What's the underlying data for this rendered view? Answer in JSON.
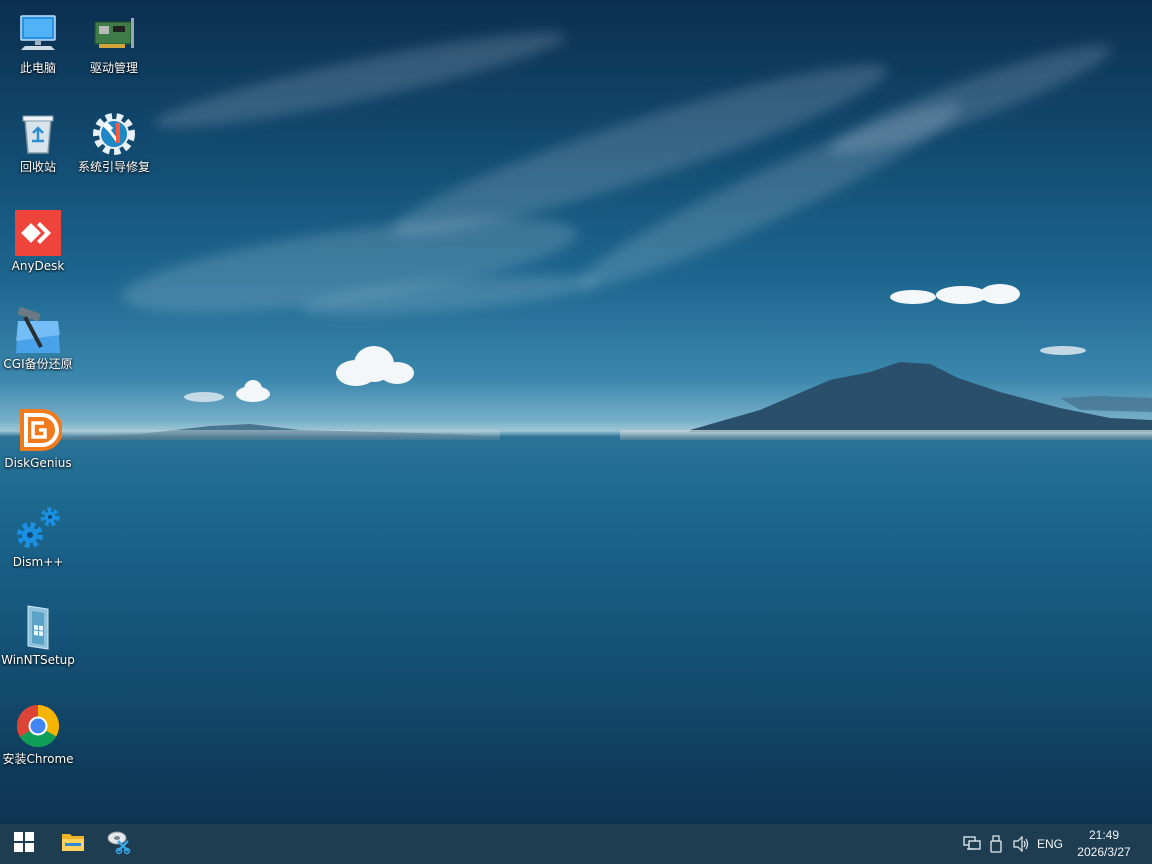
{
  "desktop": {
    "icons": [
      {
        "label": "此电脑",
        "icon": "computer-icon"
      },
      {
        "label": "驱动管理",
        "icon": "driver-card-icon"
      },
      {
        "label": "回收站",
        "icon": "recycle-bin-icon"
      },
      {
        "label": "系统引导修复",
        "icon": "boot-repair-gear-icon"
      },
      {
        "label": "AnyDesk",
        "icon": "anydesk-icon"
      },
      {
        "label": "CGI备份还原",
        "icon": "cgi-hammer-icon"
      },
      {
        "label": "DiskGenius",
        "icon": "diskgenius-icon"
      },
      {
        "label": "Dism++",
        "icon": "dism-gears-icon"
      },
      {
        "label": "WinNTSetup",
        "icon": "winntsetup-icon"
      },
      {
        "label": "安装Chrome",
        "icon": "chrome-icon"
      }
    ]
  },
  "taskbar": {
    "pinned": [
      {
        "icon": "windows-start-icon"
      },
      {
        "icon": "file-explorer-icon"
      },
      {
        "icon": "partition-tool-icon"
      }
    ],
    "tray": {
      "language": "ENG",
      "time": "21:49",
      "date": "2026/3/27",
      "icons": [
        "network-icon",
        "usb-drive-icon",
        "volume-icon"
      ]
    }
  },
  "colors": {
    "taskbar": "#1f3d50",
    "anydesk": "#ef443b",
    "diskgenius": "#f07a1c"
  }
}
